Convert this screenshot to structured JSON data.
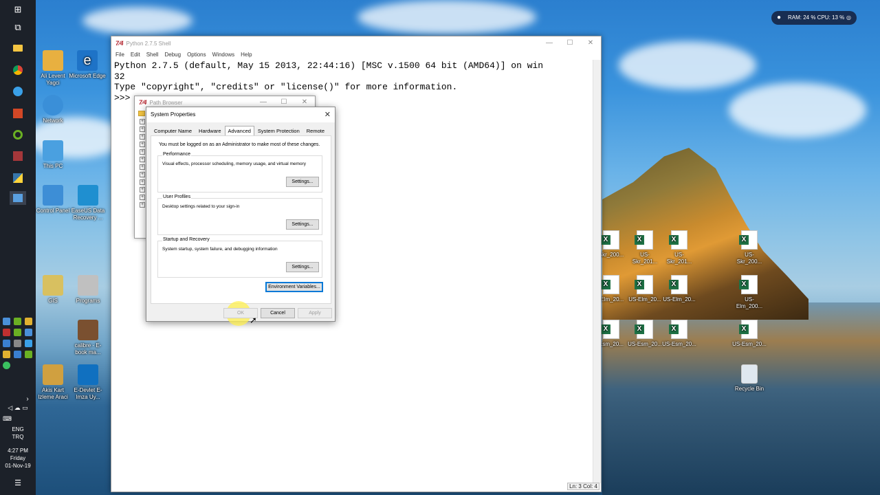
{
  "system_tray": {
    "ram_cpu": "RAM: 24 %  CPU: 13 %"
  },
  "taskbar": {
    "language": "ENG",
    "layout": "TRQ",
    "time": "4:27 PM",
    "day": "Friday",
    "date": "01-Nov-19"
  },
  "desktop_icons_left": [
    {
      "label": "Ali Levent Yagci",
      "color": "#e8b040"
    },
    {
      "label": "Microsoft Edge",
      "color": "#1e73c7"
    },
    {
      "label": "Network",
      "color": "#3a8fd8"
    },
    {
      "label": "This PC",
      "color": "#4aa0e0"
    },
    {
      "label": "Control Panel",
      "color": "#3d8ed6"
    },
    {
      "label": "EaseUS Data Recovery ...",
      "color": "#1f8fd0"
    },
    {
      "label": "GIS",
      "color": "#d8c060"
    },
    {
      "label": "Programs",
      "color": "#c0c0c0"
    },
    {
      "label": "calibre - E-book ma...",
      "color": "#7a5030"
    },
    {
      "label": "Akis Kart Izleme Araci",
      "color": "#d0a040"
    },
    {
      "label": "E-Devlet E-Imza Uy...",
      "color": "#1070c0"
    }
  ],
  "excel_files": [
    "Skr_200...",
    "US-Skr_201...",
    "US-Skr_201...",
    "US-Skr_200...",
    "-Elm_20...",
    "US-Elm_20...",
    "US-Elm_20...",
    "US-Elm_200...",
    "Esm_20...",
    "US-Esm_20...",
    "US-Esm_20...",
    "US-Esm_20..."
  ],
  "recycle_bin": "Recycle Bin",
  "python_shell": {
    "title": "Python 2.7.5 Shell",
    "menu": [
      "File",
      "Edit",
      "Shell",
      "Debug",
      "Options",
      "Windows",
      "Help"
    ],
    "line1": "Python 2.7.5 (default, May 15 2013, 22:44:16) [MSC v.1500 64 bit (AMD64)] on win",
    "line2": "32",
    "line3": "Type \"copyright\", \"credits\" or \"license()\" for more information.",
    "prompt": ">>> ",
    "status": "Ln: 3 Col: 4"
  },
  "path_browser": {
    "title": "Path Browser"
  },
  "system_properties": {
    "title": "System Properties",
    "tabs": [
      "Computer Name",
      "Hardware",
      "Advanced",
      "System Protection",
      "Remote"
    ],
    "note": "You must be logged on as an Administrator to make most of these changes.",
    "performance": {
      "label": "Performance",
      "desc": "Visual effects, processor scheduling, memory usage, and virtual memory",
      "button": "Settings..."
    },
    "user_profiles": {
      "label": "User Profiles",
      "desc": "Desktop settings related to your sign-in",
      "button": "Settings..."
    },
    "startup": {
      "label": "Startup and Recovery",
      "desc": "System startup, system failure, and debugging information",
      "button": "Settings..."
    },
    "env_button": "Environment Variables...",
    "ok": "OK",
    "cancel": "Cancel",
    "apply": "Apply"
  }
}
